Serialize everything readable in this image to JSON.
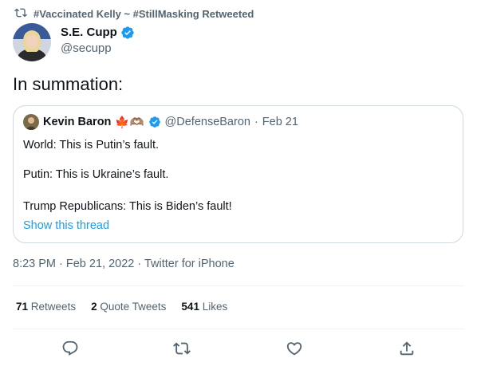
{
  "retweet_context": {
    "label": "#Vaccinated Kelly ~ #StillMasking Retweeted"
  },
  "author": {
    "display_name": "S.E. Cupp",
    "handle": "@secupp"
  },
  "tweet": {
    "text": "In summation:"
  },
  "quoted_tweet": {
    "display_name": "Kevin Baron",
    "emojis": "🍁🫶🏽",
    "handle": "@DefenseBaron",
    "separator": "·",
    "date": "Feb 21",
    "lines": [
      "World: This is Putin’s fault.",
      "Putin: This is Ukraine’s fault.",
      "Trump Republicans: This is Biden’s fault!"
    ],
    "show_thread": "Show this thread"
  },
  "meta": {
    "timestamp": "8:23 PM · Feb 21, 2022 · Twitter for iPhone"
  },
  "stats": {
    "retweets_count": "71",
    "retweets_label": "Retweets",
    "quotes_count": "2",
    "quotes_label": "Quote Tweets",
    "likes_count": "541",
    "likes_label": "Likes"
  },
  "colors": {
    "accent": "#1d9bf0",
    "text": "#0f1419",
    "muted": "#536471",
    "border": "#cfd9de",
    "flag_red": "#e0245e"
  },
  "icons": [
    "retweet-icon",
    "verified-icon",
    "reply-icon",
    "like-icon",
    "share-icon"
  ]
}
